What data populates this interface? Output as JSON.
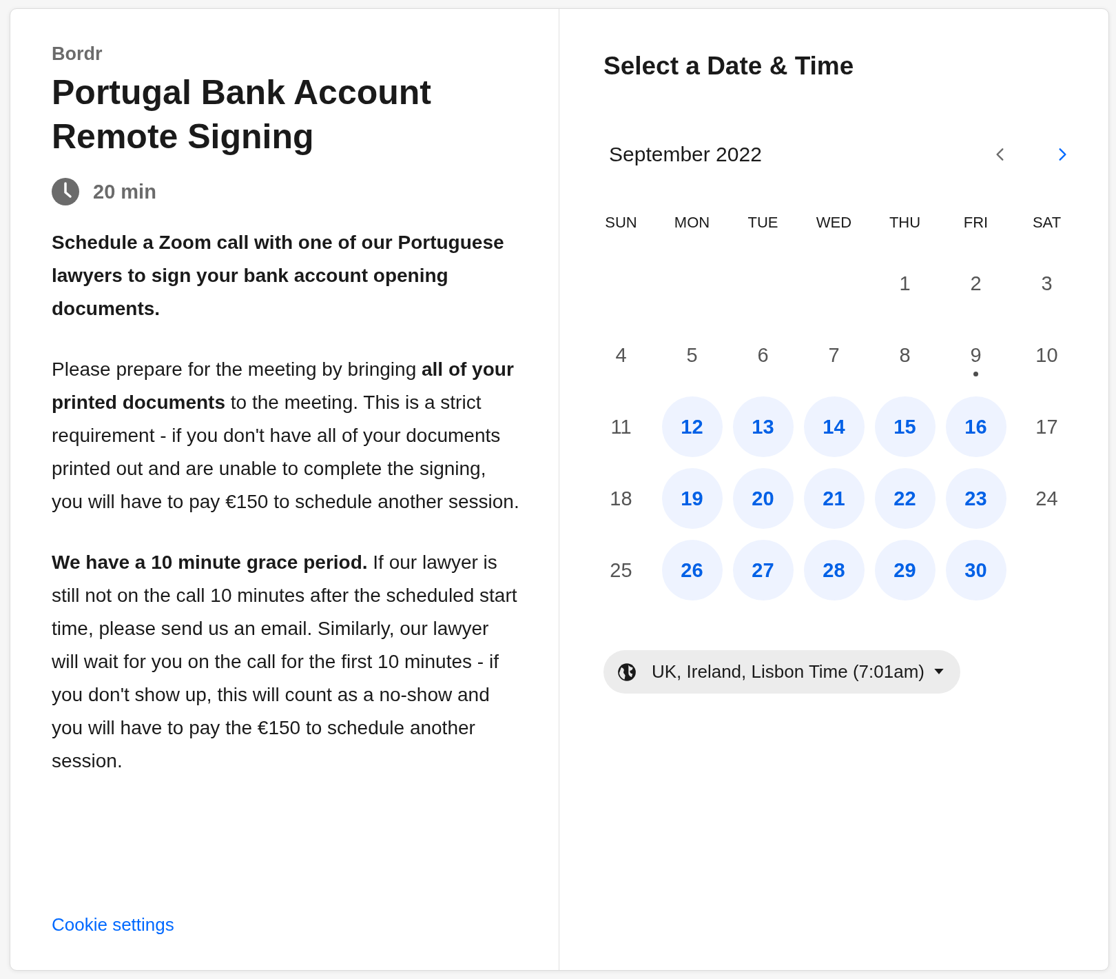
{
  "brand": "Bordr",
  "title": "Portugal Bank Account Remote Signing",
  "duration": "20 min",
  "paragraphs": [
    {
      "kind": "lead",
      "text": "Schedule a Zoom call with one of our Portuguese lawyers to sign your bank account opening documents."
    },
    {
      "kind": "body",
      "text": "Please prepare for the meeting by bringing **all of your printed documents** to the meeting. This is a strict requirement - if you don't have all of your documents printed out and are unable to complete the signing, you will have to pay €150 to schedule another session."
    },
    {
      "kind": "body",
      "text": "**We have a 10 minute grace period.** If our lawyer is still not on the call 10 minutes after the scheduled start time, please send us an email. Similarly, our lawyer will wait for you on the call for the first 10 minutes - if you don't show up, this will count as a no-show and you will have to pay the €150 to schedule another session."
    }
  ],
  "cookie_link": "Cookie settings",
  "calendar": {
    "heading": "Select a Date & Time",
    "month": "September 2022",
    "prev": {
      "disabled": true
    },
    "next": {
      "disabled": false
    },
    "weekdays": [
      "SUN",
      "MON",
      "TUE",
      "WED",
      "THU",
      "FRI",
      "SAT"
    ],
    "weeks": [
      [
        {
          "kind": "empty"
        },
        {
          "kind": "empty"
        },
        {
          "kind": "empty"
        },
        {
          "kind": "empty"
        },
        {
          "kind": "day",
          "label": "1",
          "available": false,
          "today": false
        },
        {
          "kind": "day",
          "label": "2",
          "available": false,
          "today": false
        },
        {
          "kind": "day",
          "label": "3",
          "available": false,
          "today": false
        }
      ],
      [
        {
          "kind": "day",
          "label": "4",
          "available": false,
          "today": false
        },
        {
          "kind": "day",
          "label": "5",
          "available": false,
          "today": false
        },
        {
          "kind": "day",
          "label": "6",
          "available": false,
          "today": false
        },
        {
          "kind": "day",
          "label": "7",
          "available": false,
          "today": false
        },
        {
          "kind": "day",
          "label": "8",
          "available": false,
          "today": false
        },
        {
          "kind": "day",
          "label": "9",
          "available": false,
          "today": true
        },
        {
          "kind": "day",
          "label": "10",
          "available": false,
          "today": false
        }
      ],
      [
        {
          "kind": "day",
          "label": "11",
          "available": false,
          "today": false
        },
        {
          "kind": "day",
          "label": "12",
          "available": true,
          "today": false
        },
        {
          "kind": "day",
          "label": "13",
          "available": true,
          "today": false
        },
        {
          "kind": "day",
          "label": "14",
          "available": true,
          "today": false
        },
        {
          "kind": "day",
          "label": "15",
          "available": true,
          "today": false
        },
        {
          "kind": "day",
          "label": "16",
          "available": true,
          "today": false
        },
        {
          "kind": "day",
          "label": "17",
          "available": false,
          "today": false
        }
      ],
      [
        {
          "kind": "day",
          "label": "18",
          "available": false,
          "today": false
        },
        {
          "kind": "day",
          "label": "19",
          "available": true,
          "today": false
        },
        {
          "kind": "day",
          "label": "20",
          "available": true,
          "today": false
        },
        {
          "kind": "day",
          "label": "21",
          "available": true,
          "today": false
        },
        {
          "kind": "day",
          "label": "22",
          "available": true,
          "today": false
        },
        {
          "kind": "day",
          "label": "23",
          "available": true,
          "today": false
        },
        {
          "kind": "day",
          "label": "24",
          "available": false,
          "today": false
        }
      ],
      [
        {
          "kind": "day",
          "label": "25",
          "available": false,
          "today": false
        },
        {
          "kind": "day",
          "label": "26",
          "available": true,
          "today": false
        },
        {
          "kind": "day",
          "label": "27",
          "available": true,
          "today": false
        },
        {
          "kind": "day",
          "label": "28",
          "available": true,
          "today": false
        },
        {
          "kind": "day",
          "label": "29",
          "available": true,
          "today": false
        },
        {
          "kind": "day",
          "label": "30",
          "available": true,
          "today": false
        },
        {
          "kind": "empty"
        }
      ]
    ],
    "timezone": "UK, Ireland, Lisbon Time (7:01am)"
  }
}
